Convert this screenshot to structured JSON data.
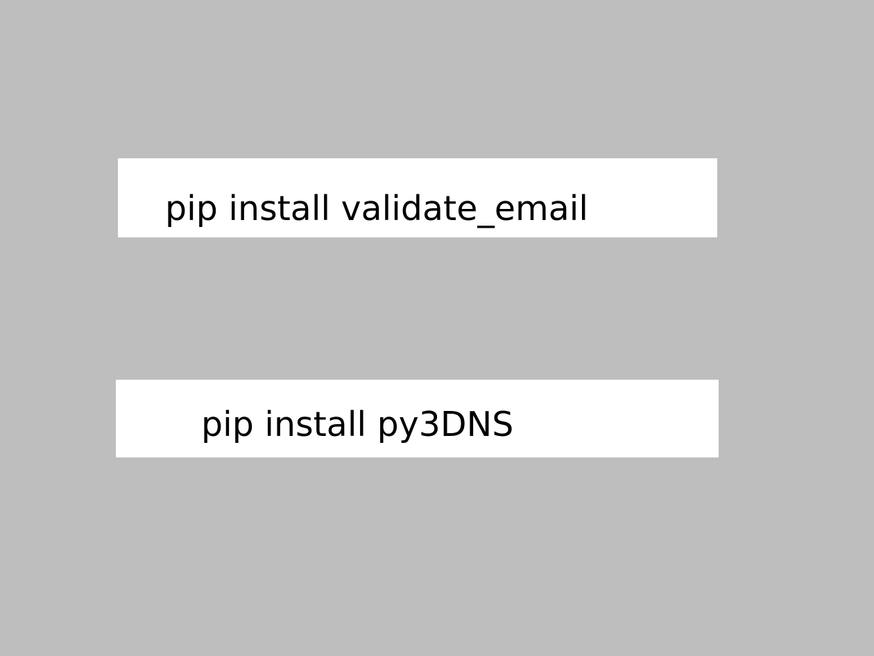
{
  "commands": [
    {
      "text": "pip install validate_email"
    },
    {
      "text": "pip install py3DNS"
    }
  ],
  "colors": {
    "background": "#bebebe",
    "box": "#ffffff",
    "text": "#000000"
  }
}
